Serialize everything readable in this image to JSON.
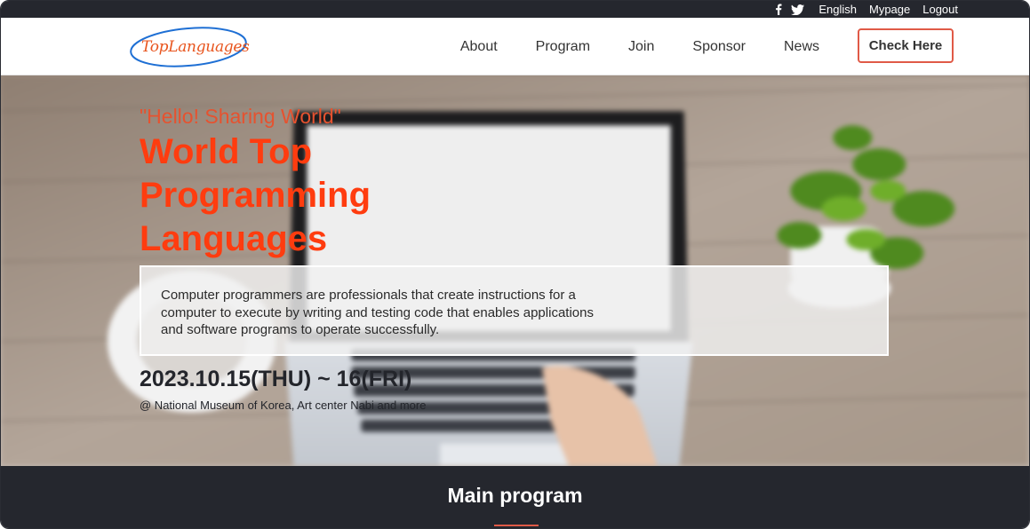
{
  "topbar": {
    "social_icons": [
      "facebook-icon",
      "twitter-icon"
    ],
    "links": [
      "English",
      "Mypage",
      "Logout"
    ]
  },
  "header": {
    "logo_text": "TopLanguages",
    "nav": [
      "About",
      "Program",
      "Join",
      "Sponsor",
      "News"
    ],
    "cta_label": "Check Here"
  },
  "hero": {
    "tagline": "\"Hello! Sharing World\"",
    "title": "World Top Programming Languages",
    "description": "Computer programmers are professionals that create instructions for a computer to execute by writing and testing code that enables applications and software programs to operate successfully.",
    "date": "2023.10.15(THU) ~ 16(FRI)",
    "venue": "@ National Museum of Korea, Art center Nabi and more"
  },
  "program": {
    "title": "Main program"
  },
  "colors": {
    "accent": "#e05a47",
    "title_orange": "#ff3c0f",
    "dark_bar": "#25272e"
  }
}
